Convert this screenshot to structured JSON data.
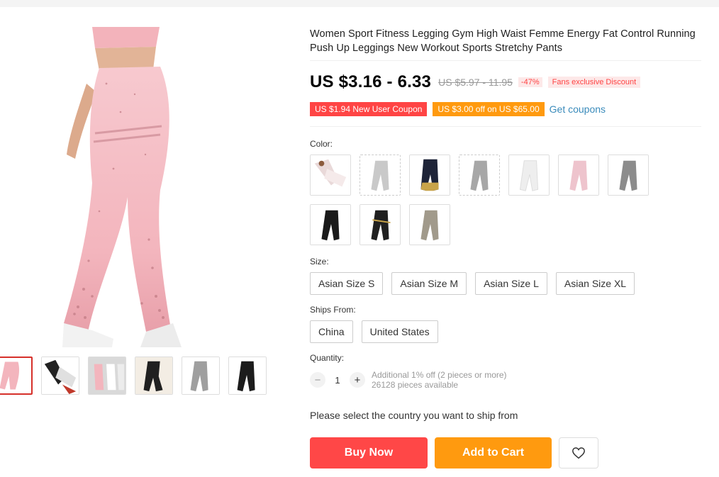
{
  "product": {
    "title": "Women Sport Fitness Legging Gym High Waist Femme Energy Fat Control Running Push Up Leggings New Workout Sports Stretchy Pants",
    "price": "US $3.16 - 6.33",
    "old_price": "US $5.97 - 11.95",
    "discount": "-47%",
    "fans_discount": "Fans exclusive Discount"
  },
  "coupons": {
    "new_user": "US $1.94 New User Coupon",
    "store": "US $3.00 off on US $65.00",
    "get_coupons": "Get coupons"
  },
  "color": {
    "label": "Color:",
    "swatches": [
      {
        "icon": "pink-white-leggings",
        "color": "#e9d9d9"
      },
      {
        "icon": "light-gray-leggings",
        "color": "#c9c9c9"
      },
      {
        "icon": "navy-gold-leggings",
        "color": "#1e2438"
      },
      {
        "icon": "gray-leggings",
        "color": "#a7a7a7"
      },
      {
        "icon": "white-leggings",
        "color": "#eeeeee"
      },
      {
        "icon": "pink-leggings",
        "color": "#eec4cd"
      },
      {
        "icon": "dark-gray-leggings",
        "color": "#8c8c8c"
      },
      {
        "icon": "black-leggings",
        "color": "#1a1a1a"
      },
      {
        "icon": "black-gold-leggings",
        "color": "#202020"
      },
      {
        "icon": "khaki-leggings",
        "color": "#a19a8b"
      }
    ]
  },
  "size": {
    "label": "Size:",
    "options": [
      "Asian Size S",
      "Asian Size M",
      "Asian Size L",
      "Asian Size XL"
    ]
  },
  "ships_from": {
    "label": "Ships From:",
    "options": [
      "China",
      "United States"
    ]
  },
  "quantity": {
    "label": "Quantity:",
    "minus": "−",
    "value": "1",
    "plus": "+",
    "additional": "Additional 1% off (2 pieces or more)",
    "available": "26128 pieces available"
  },
  "ship_message": "Please select the country you want to ship from",
  "actions": {
    "buy_now": "Buy Now",
    "add_to_cart": "Add to Cart",
    "wishlist_icon": "heart-icon"
  },
  "colors": {
    "accent_red": "#ff4747",
    "accent_orange": "#ff9a0f",
    "link_blue": "#3a8bbb"
  }
}
